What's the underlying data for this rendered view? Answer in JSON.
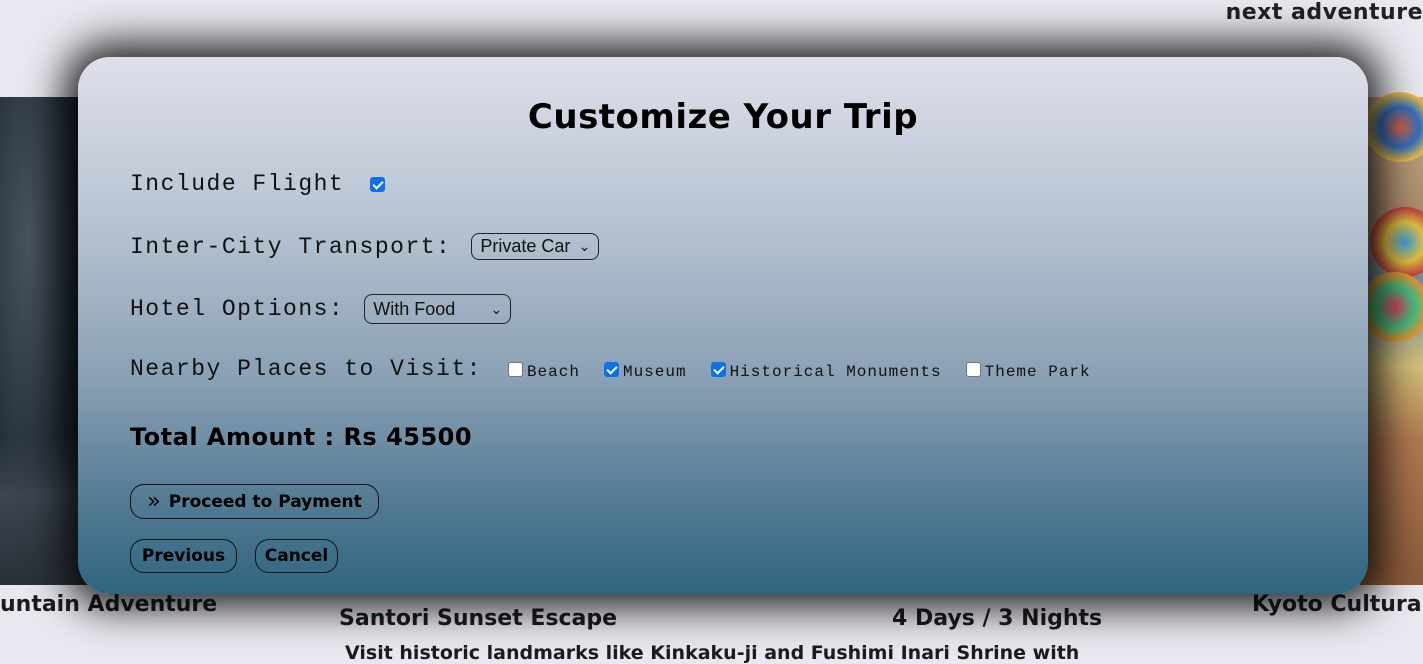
{
  "background": {
    "header_text": "next adventure",
    "captions": {
      "left": "untain Adventure",
      "middle": "Santori Sunset Escape",
      "duration": "4 Days / 3 Nights",
      "right": "Kyoto Cultura",
      "description": "Visit historic landmarks like Kinkaku-ji and Fushimi Inari Shrine with"
    }
  },
  "modal": {
    "title": "Customize Your Trip",
    "include_flight": {
      "label": "Include Flight",
      "checked": true
    },
    "transport": {
      "label": "Inter-City Transport:",
      "selected": "Private Car"
    },
    "hotel": {
      "label": "Hotel Options:",
      "selected": "With Food"
    },
    "nearby": {
      "label": "Nearby Places to Visit:",
      "options": [
        {
          "label": "Beach",
          "checked": false
        },
        {
          "label": "Museum",
          "checked": true
        },
        {
          "label": "Historical Monuments",
          "checked": true
        },
        {
          "label": "Theme Park",
          "checked": false
        }
      ]
    },
    "total": "Total Amount : Rs 45500",
    "buttons": {
      "proceed": "Proceed to Payment",
      "previous": "Previous",
      "cancel": "Cancel"
    }
  },
  "colors": {
    "checkbox_accent": "#0b73e8"
  }
}
